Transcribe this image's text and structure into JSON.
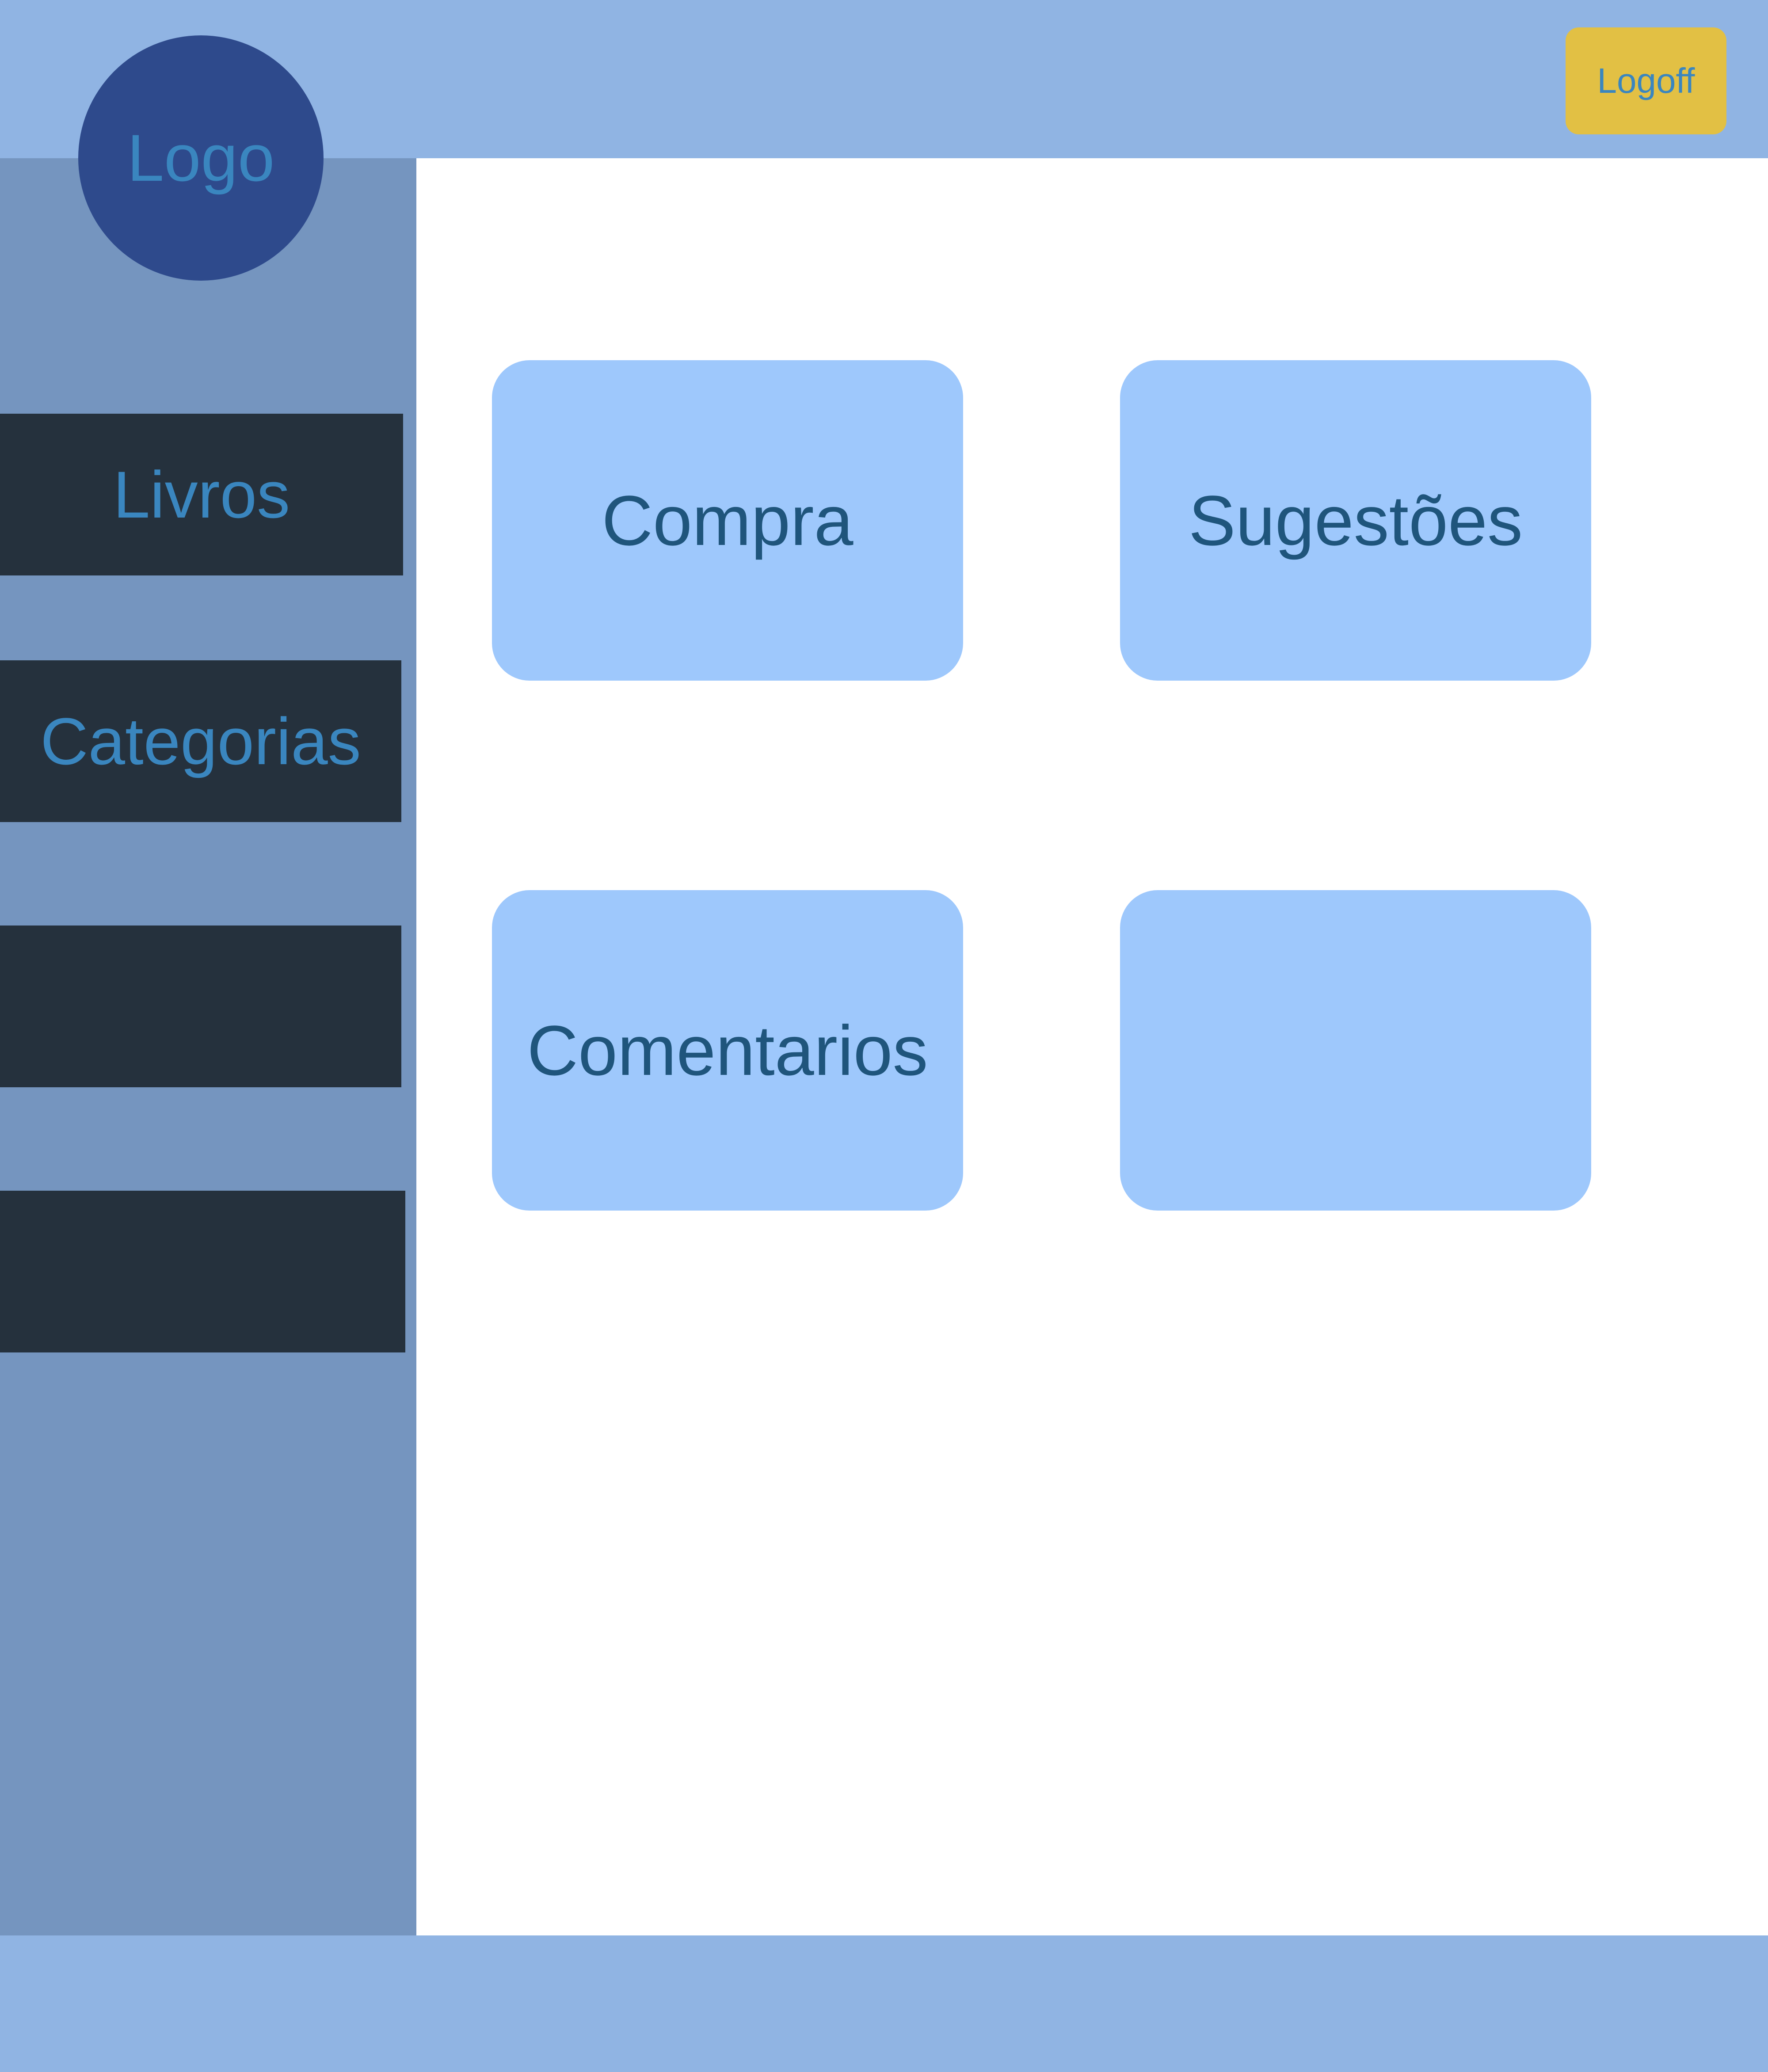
{
  "header": {
    "logo_label": "Logo",
    "logoff_label": "Logoff"
  },
  "sidebar": {
    "items": [
      {
        "label": "Livros"
      },
      {
        "label": "Categorias"
      },
      {
        "label": ""
      },
      {
        "label": ""
      }
    ]
  },
  "main": {
    "cards": [
      {
        "label": "Compra"
      },
      {
        "label": "Sugestões"
      },
      {
        "label": "Comentarios"
      },
      {
        "label": ""
      }
    ]
  },
  "colors": {
    "header_background": "#90b4e3",
    "sidebar_background": "#7595bf",
    "logo_circle": "#2e4a8c",
    "logoff_button": "#e2c044",
    "nav_item_background": "#25313d",
    "nav_text": "#3a86bf",
    "card_background": "#9ec8fc",
    "card_text": "#1f557c"
  }
}
